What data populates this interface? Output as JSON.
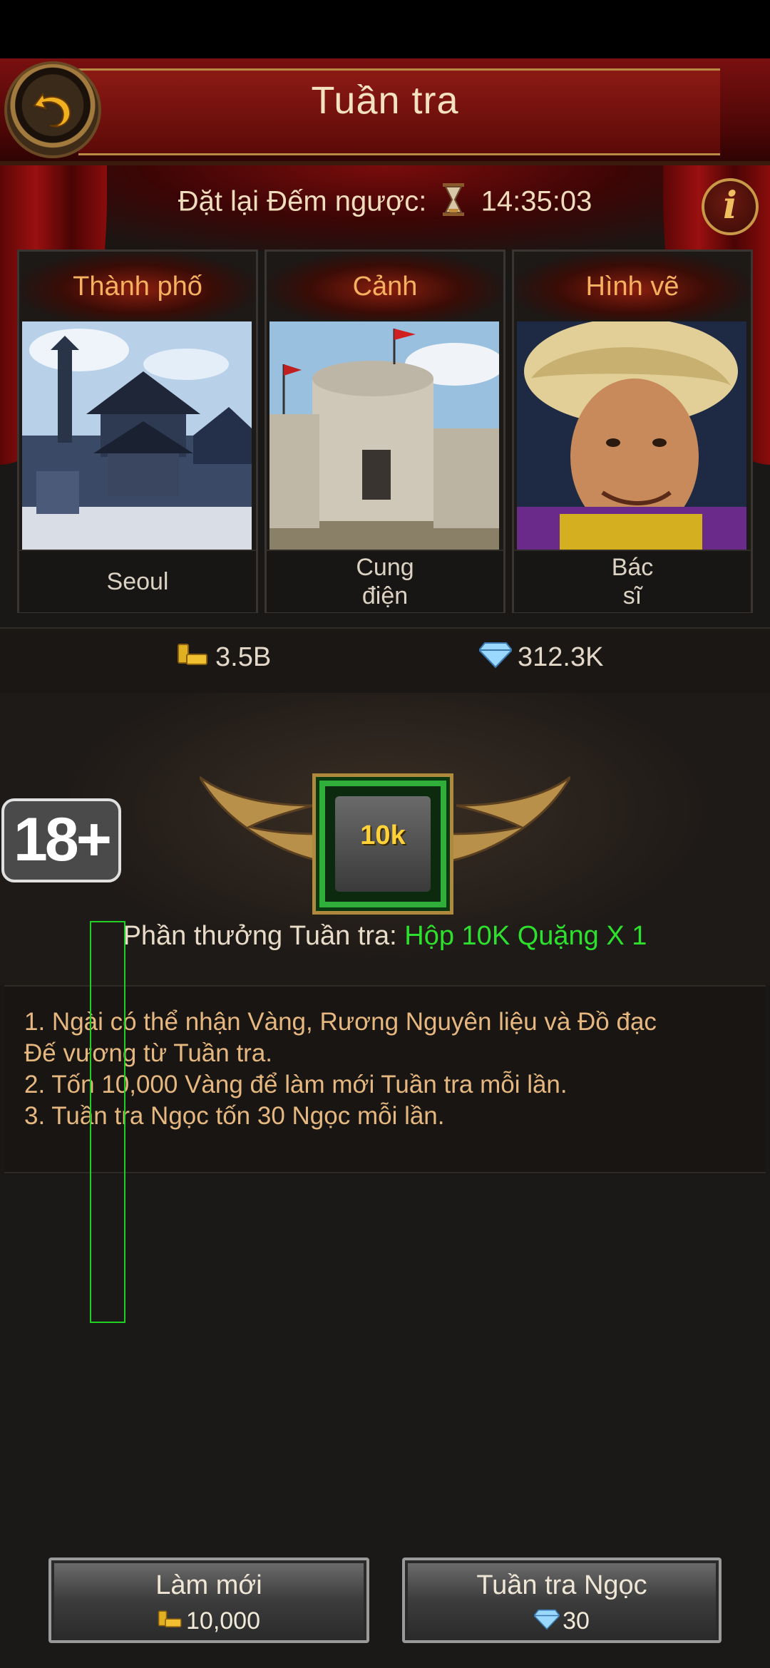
{
  "header": {
    "title": "Tuần tra"
  },
  "countdown": {
    "label": "Đặt lại Đếm ngược:",
    "time": "14:35:03"
  },
  "cards": [
    {
      "category": "Thành phố",
      "caption": "Seoul"
    },
    {
      "category": "Cảnh",
      "caption": "Cung\nđiện"
    },
    {
      "category": "Hình vẽ",
      "caption": "Bác\nsĩ"
    }
  ],
  "resources": {
    "gold": "3.5B",
    "gems": "312.3K"
  },
  "reward": {
    "box_label": "10k",
    "prefix": "Phần thưởng Tuần tra:",
    "item": "Hộp 10K Quặng X 1"
  },
  "age_rating": "18+",
  "description": [
    "1. Ngài có thể nhận Vàng, Rương Nguyên liệu và Đồ đạc",
    "Đế vương từ Tuần tra.",
    "2. Tốn 10,000 Vàng để làm mới Tuần tra mỗi lần.",
    "3. Tuần tra Ngọc tốn 30 Ngọc mỗi lần."
  ],
  "buttons": {
    "refresh": {
      "label": "Làm mới",
      "cost": "10,000"
    },
    "gem_patrol": {
      "label": "Tuần tra Ngọc",
      "cost": "30"
    }
  },
  "colors": {
    "accent_green": "#2ee02e",
    "title_orange": "#f5b060",
    "header_red": "#7a1010"
  }
}
